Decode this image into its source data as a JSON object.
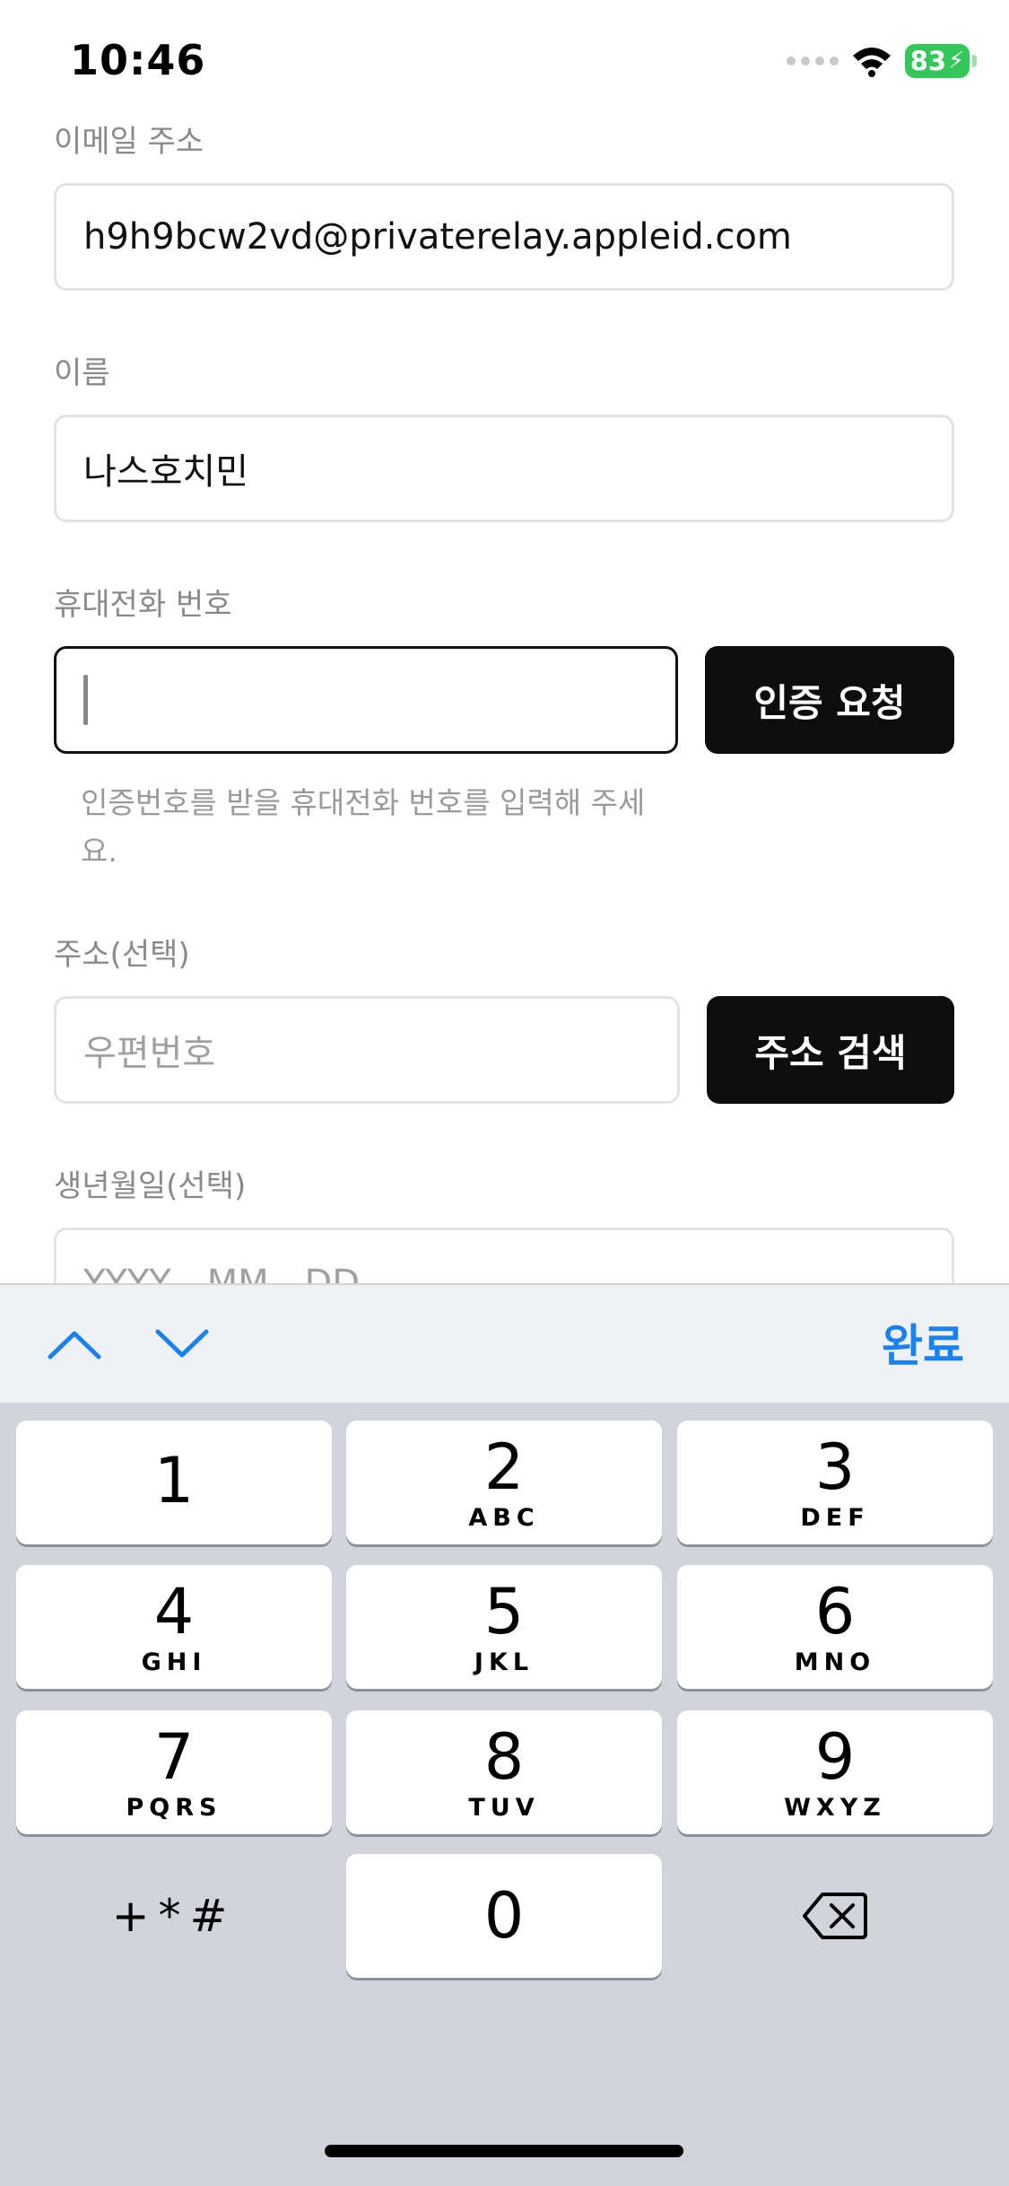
{
  "status_bar": {
    "time": "10:46",
    "battery": "83"
  },
  "form": {
    "email": {
      "label": "이메일 주소",
      "value": "h9h9bcw2vd@privaterelay.appleid.com"
    },
    "name": {
      "label": "이름",
      "value": "나스호치민"
    },
    "phone": {
      "label": "휴대전화 번호",
      "value": "",
      "button": "인증 요청",
      "helper": "인증번호를 받을 휴대전화 번호를 입력해 주세요."
    },
    "address": {
      "label": "주소(선택)",
      "placeholder": "우편번호",
      "button": "주소 검색"
    },
    "birthdate": {
      "label": "생년월일(선택)",
      "placeholder": "YYYY - MM - DD"
    }
  },
  "accessory_bar": {
    "done_label": "완료"
  },
  "keyboard": {
    "keys": [
      {
        "digit": "1",
        "letters": ""
      },
      {
        "digit": "2",
        "letters": "ABC"
      },
      {
        "digit": "3",
        "letters": "DEF"
      },
      {
        "digit": "4",
        "letters": "GHI"
      },
      {
        "digit": "5",
        "letters": "JKL"
      },
      {
        "digit": "6",
        "letters": "MNO"
      },
      {
        "digit": "7",
        "letters": "PQRS"
      },
      {
        "digit": "8",
        "letters": "TUV"
      },
      {
        "digit": "9",
        "letters": "WXYZ"
      },
      {
        "digit": "0",
        "letters": ""
      }
    ],
    "symbols_label": "+*#"
  },
  "colors": {
    "accent": "#1a82f0",
    "button_bg": "#0d0d0d",
    "battery": "#34c759",
    "keyboard_bg": "#d1d4da"
  }
}
